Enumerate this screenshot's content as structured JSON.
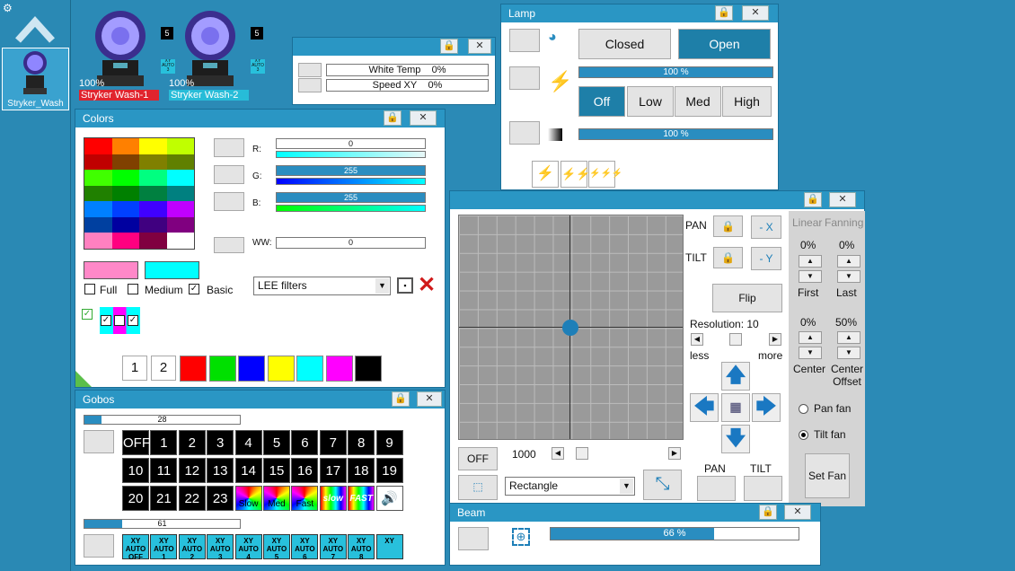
{
  "sidebar": {
    "fixture_label": "Stryker_Wash"
  },
  "fixtures": [
    {
      "name": "Stryker Wash-1",
      "intensity": "100%",
      "badge": "5",
      "color": "#e0242e"
    },
    {
      "name": "Stryker Wash-2",
      "intensity": "100%",
      "badge": "5",
      "color": "#27bcd8"
    }
  ],
  "xy_badge": "XY AUTO 3",
  "small_win": {
    "rows": [
      {
        "label": "White Temp",
        "value": "0%"
      },
      {
        "label": "Speed XY",
        "value": "0%"
      }
    ]
  },
  "lamp": {
    "title": "Lamp",
    "closed": "Closed",
    "open": "Open",
    "bar1": "100 %",
    "bar1_pct": 1.0,
    "off": "Off",
    "low": "Low",
    "med": "Med",
    "high": "High",
    "bar2": "100 %",
    "bar2_pct": 1.0
  },
  "colors": {
    "title": "Colors",
    "r_label": "R:",
    "g_label": "G:",
    "b_label": "B:",
    "ww_label": "WW:",
    "r": "0",
    "g": "255",
    "b": "255",
    "ww": "0",
    "r_pct": 0,
    "g_pct": 1,
    "b_pct": 1,
    "ww_pct": 0,
    "opt_full": "Full",
    "opt_medium": "Medium",
    "opt_basic": "Basic",
    "filter": "LEE filters",
    "preset1": "1",
    "preset2": "2",
    "grid": [
      "#ff0000",
      "#ff8000",
      "#ffff00",
      "#c0ff00",
      "#c00000",
      "#804000",
      "#808000",
      "#608000",
      "#40ff00",
      "#00ff00",
      "#00ff80",
      "#00ffff",
      "#208000",
      "#008000",
      "#008040",
      "#008080",
      "#0080ff",
      "#0040ff",
      "#4000ff",
      "#c000ff",
      "#0040a0",
      "#0000a0",
      "#400080",
      "#800080",
      "#ff80c0",
      "#ff0080",
      "#800040",
      "#ffffff"
    ],
    "swatch_a": "#ff88c8",
    "swatch_b": "#00ffff",
    "presets": [
      "#ff0000",
      "#00e000",
      "#0000ff",
      "#ffff00",
      "#00ffff",
      "#ff00ff",
      "#000000"
    ]
  },
  "gobos": {
    "title": "Gobos",
    "bar1": "28",
    "bar1_pct": 0.11,
    "bar2": "61",
    "bar2_pct": 0.24,
    "row1": [
      "OFF",
      "1",
      "2",
      "3",
      "4",
      "5",
      "6",
      "7",
      "8",
      "9"
    ],
    "row2": [
      "10",
      "11",
      "12",
      "13",
      "14",
      "15",
      "16",
      "17",
      "18",
      "19"
    ],
    "row3": [
      "20",
      "21",
      "22",
      "23",
      "Slow",
      "Med",
      "Fast",
      "slow",
      "FAST"
    ],
    "xy": [
      "XY AUTO OFF",
      "XY AUTO 1",
      "XY AUTO 2",
      "XY AUTO 3",
      "XY AUTO 4",
      "XY AUTO 5",
      "XY AUTO 6",
      "XY AUTO 7",
      "XY AUTO 8",
      "XY"
    ]
  },
  "position": {
    "pan": "PAN",
    "tilt": "TILT",
    "neg_x": "- X",
    "neg_y": "- Y",
    "flip": "Flip",
    "resolution": "Resolution: 10",
    "less": "less",
    "more": "more",
    "off": "OFF",
    "speed": "1000",
    "shape": "Rectangle",
    "pan_btn": "PAN",
    "tilt_btn": "TILT",
    "linear": "Linear",
    "fanning": "Fanning",
    "first_val": "0%",
    "last_val": "0%",
    "first": "First",
    "last": "Last",
    "center_val": "0%",
    "offset_val": "50%",
    "center": "Center",
    "offset": "Center Offset",
    "pan_fan": "Pan fan",
    "tilt_fan": "Tilt fan",
    "set_fan": "Set Fan"
  },
  "beam": {
    "title": "Beam",
    "value": "66 %",
    "pct": 0.66
  }
}
